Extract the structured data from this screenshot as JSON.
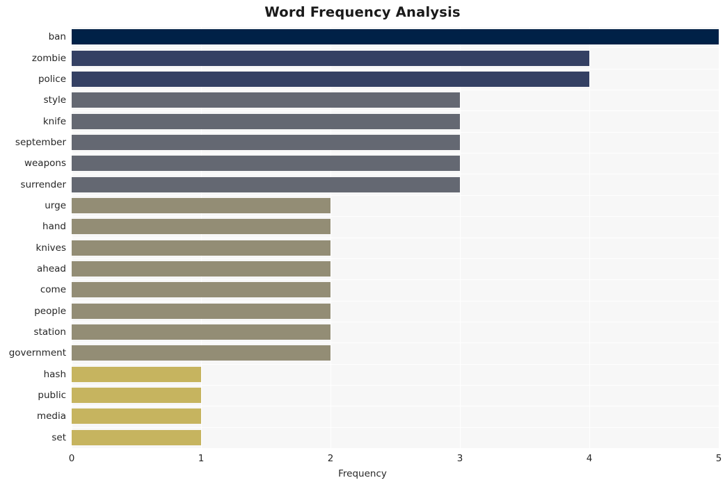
{
  "chart_data": {
    "type": "bar",
    "orientation": "horizontal",
    "title": "Word Frequency Analysis",
    "xlabel": "Frequency",
    "ylabel": "",
    "xlim": [
      0,
      5
    ],
    "ylim": null,
    "grid": true,
    "legend": null,
    "xticks": [
      "0",
      "1",
      "2",
      "3",
      "4",
      "5"
    ],
    "xtick_values": [
      0,
      1,
      2,
      3,
      4,
      5
    ],
    "categories": [
      "ban",
      "zombie",
      "police",
      "style",
      "knife",
      "september",
      "weapons",
      "surrender",
      "urge",
      "hand",
      "knives",
      "ahead",
      "come",
      "people",
      "station",
      "government",
      "hash",
      "public",
      "media",
      "set"
    ],
    "values": [
      5,
      4,
      4,
      3,
      3,
      3,
      3,
      3,
      2,
      2,
      2,
      2,
      2,
      2,
      2,
      2,
      1,
      1,
      1,
      1
    ],
    "bar_colors": [
      "#002147",
      "#344063",
      "#344063",
      "#646872",
      "#646872",
      "#646872",
      "#646872",
      "#646872",
      "#938d75",
      "#938d75",
      "#938d75",
      "#938d75",
      "#938d75",
      "#938d75",
      "#938d75",
      "#938d75",
      "#c6b45f",
      "#c6b45f",
      "#c6b45f",
      "#c6b45f"
    ],
    "palette": {
      "value_5": "#002147",
      "value_4": "#344063",
      "value_3": "#646872",
      "value_2": "#938d75",
      "value_1": "#c6b45f"
    },
    "plot_background": "#f7f7f7",
    "gridline_color": "#ffffff",
    "figure_background": "#ffffff",
    "text_color": "#262626"
  }
}
